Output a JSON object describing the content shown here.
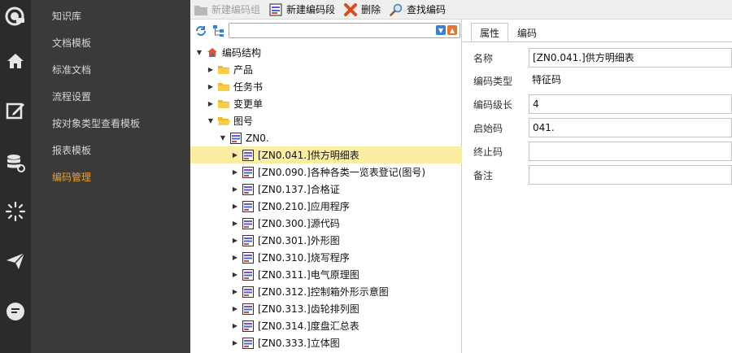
{
  "nav": {
    "items": [
      {
        "label": "知识库",
        "active": false
      },
      {
        "label": "文档模板",
        "active": false
      },
      {
        "label": "标准文档",
        "active": false
      },
      {
        "label": "流程设置",
        "active": false
      },
      {
        "label": "按对象类型查看模板",
        "active": false
      },
      {
        "label": "报表模板",
        "active": false
      },
      {
        "label": "编码管理",
        "active": true
      }
    ],
    "active_color": "#f0a023"
  },
  "rail": {
    "icons": [
      "sepm-logo-icon",
      "home-icon",
      "edit-icon",
      "database-gear-icon",
      "loading-icon",
      "send-icon",
      "chat-icon"
    ]
  },
  "toolbar": {
    "new_group_label": "新建编码组",
    "new_segment_label": "新建编码段",
    "delete_label": "删除",
    "find_label": "查找编码"
  },
  "tree": {
    "search_placeholder": "",
    "root_label": "编码结构",
    "nodes": [
      {
        "label": "产品",
        "level": 1,
        "expanded": false,
        "icon": "folder-icon"
      },
      {
        "label": "任务书",
        "level": 1,
        "expanded": false,
        "icon": "folder-icon"
      },
      {
        "label": "变更单",
        "level": 1,
        "expanded": false,
        "icon": "folder-icon"
      },
      {
        "label": "图号",
        "level": 1,
        "expanded": true,
        "icon": "folder-icon"
      },
      {
        "label": "ZN0.",
        "level": 2,
        "expanded": true,
        "icon": "code-doc-icon"
      },
      {
        "label": "[ZN0.041.]供方明细表",
        "level": 3,
        "expanded": false,
        "icon": "code-doc-icon",
        "selected": true
      },
      {
        "label": "[ZN0.090.]各种各类一览表登记(图号)",
        "level": 3,
        "expanded": false,
        "icon": "code-doc-icon"
      },
      {
        "label": "[ZN0.137.]合格证",
        "level": 3,
        "expanded": false,
        "icon": "code-doc-icon"
      },
      {
        "label": "[ZN0.210.]应用程序",
        "level": 3,
        "expanded": false,
        "icon": "code-doc-icon"
      },
      {
        "label": "[ZN0.300.]源代码",
        "level": 3,
        "expanded": false,
        "icon": "code-doc-icon"
      },
      {
        "label": "[ZN0.301.]外形图",
        "level": 3,
        "expanded": false,
        "icon": "code-doc-icon"
      },
      {
        "label": "[ZN0.310.]烧写程序",
        "level": 3,
        "expanded": false,
        "icon": "code-doc-icon"
      },
      {
        "label": "[ZN0.311.]电气原理图",
        "level": 3,
        "expanded": false,
        "icon": "code-doc-icon"
      },
      {
        "label": "[ZN0.312.]控制箱外形示意图",
        "level": 3,
        "expanded": false,
        "icon": "code-doc-icon"
      },
      {
        "label": "[ZN0.313.]齿轮排列图",
        "level": 3,
        "expanded": false,
        "icon": "code-doc-icon"
      },
      {
        "label": "[ZN0.314.]度盘汇总表",
        "level": 3,
        "expanded": false,
        "icon": "code-doc-icon"
      },
      {
        "label": "[ZN0.333.]立体图",
        "level": 3,
        "expanded": false,
        "icon": "code-doc-icon"
      }
    ]
  },
  "details": {
    "tabs": [
      {
        "label": "属性",
        "active": true
      },
      {
        "label": "编码",
        "active": false
      }
    ],
    "fields": [
      {
        "label": "名称",
        "value": "[ZN0.041.]供方明细表",
        "boxed": true
      },
      {
        "label": "编码类型",
        "value": "特征码",
        "boxed": false
      },
      {
        "label": "编码级长",
        "value": "4",
        "boxed": true
      },
      {
        "label": "启始码",
        "value": "041.",
        "boxed": true
      },
      {
        "label": "终止码",
        "value": "",
        "boxed": true
      },
      {
        "label": "备注",
        "value": "",
        "boxed": true
      }
    ]
  },
  "colors": {
    "rail_bg": "#2b2b2b",
    "nav_bg": "#3a3a3a",
    "selected_row_bg": "#fbeea3",
    "folder": "#f3b928"
  }
}
